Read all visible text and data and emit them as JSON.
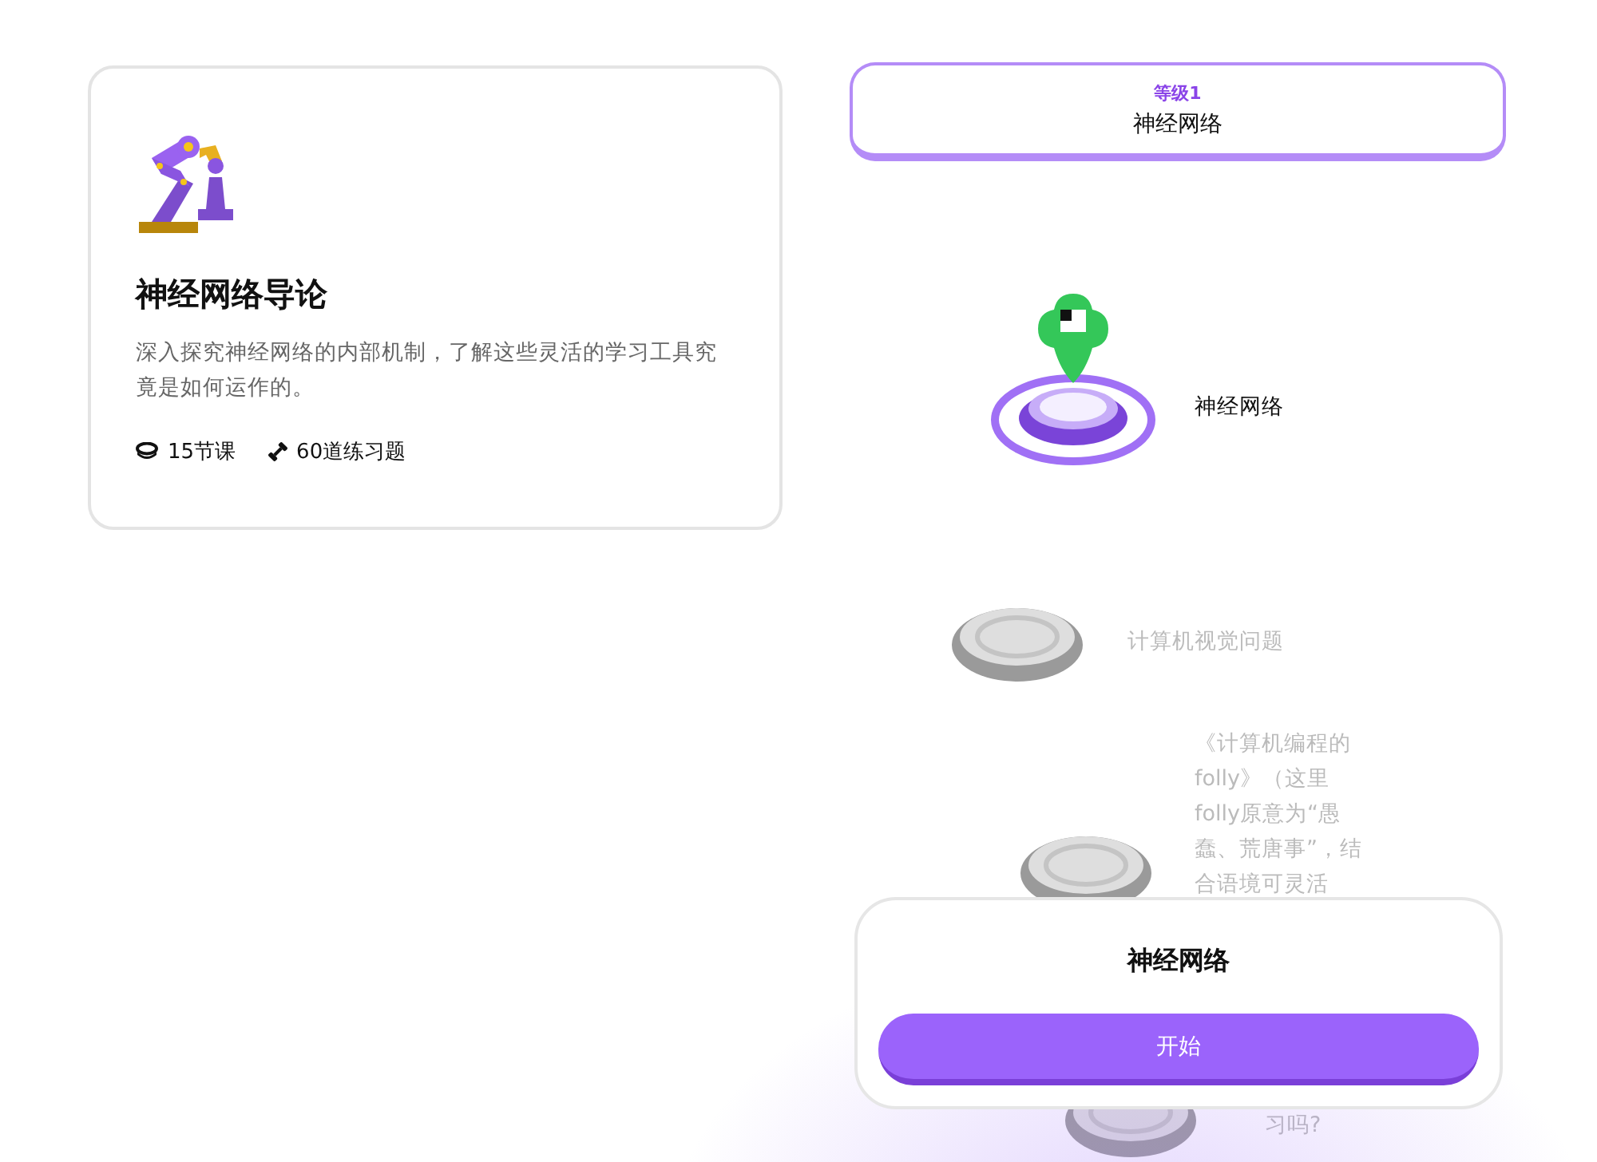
{
  "course": {
    "title": "神经网络导论",
    "description": "深入探究神经网络的内部机制，了解这些灵活的学习工具究竟是如何运作的。",
    "lessons": "15节课",
    "exercises": "60道练习题"
  },
  "level_header": {
    "level": "等级1",
    "title": "神经网络"
  },
  "path_nodes": [
    {
      "label": "神经网络",
      "current": true
    },
    {
      "label": "计算机视觉问题",
      "current": false
    },
    {
      "label": "《计算机编程的folly》（这里folly原意为“愚蠢、荒唐事”，结合语境可灵活",
      "current": false
    },
    {
      "label": "习吗?",
      "current": false
    }
  ],
  "popup": {
    "title": "神经网络",
    "button": "开始"
  }
}
